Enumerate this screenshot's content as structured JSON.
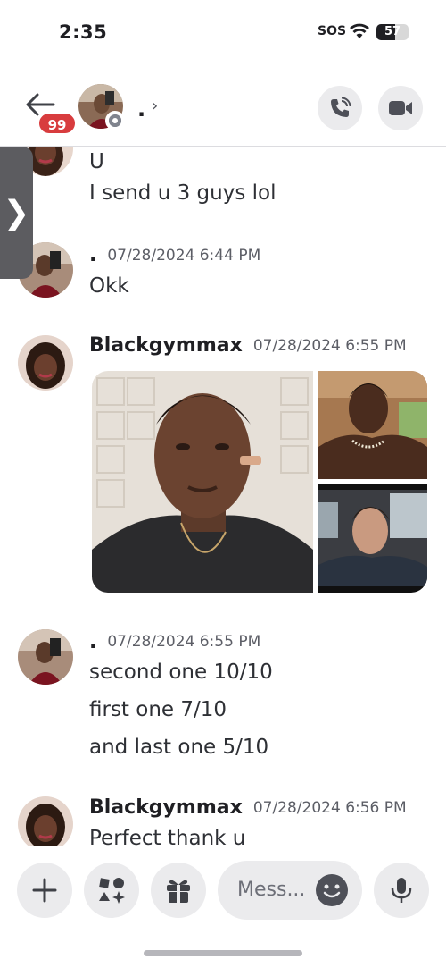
{
  "status_bar": {
    "time": "2:35",
    "sos": "SOS",
    "battery_level": "57",
    "battery_fraction": 0.57
  },
  "header": {
    "unread_badge": "99",
    "channel_name": ".",
    "chevron": "›",
    "icons": {
      "back": "back-arrow-icon",
      "call": "phone-call-icon",
      "video": "video-camera-icon"
    }
  },
  "side_handle": {
    "glyph": "❯"
  },
  "messages": [
    {
      "author": "",
      "timestamp": "",
      "lines": [
        "U",
        "I send u 3 guys lol"
      ]
    },
    {
      "author": ".",
      "timestamp": "07/28/2024 6:44 PM",
      "lines": [
        "Okk"
      ]
    },
    {
      "author": "Blackgymmax",
      "timestamp": "07/28/2024 6:55 PM",
      "lines": [],
      "attachments": 3
    },
    {
      "author": ".",
      "timestamp": "07/28/2024 6:55 PM",
      "lines": [
        "second one 10/10",
        "first one 7/10",
        "and last one 5/10"
      ]
    },
    {
      "author": "Blackgymmax",
      "timestamp": "07/28/2024 6:56 PM",
      "lines": [
        "Perfect thank u"
      ]
    }
  ],
  "composer": {
    "placeholder": "Mess...",
    "icons": {
      "add": "plus-icon",
      "apps": "apps-icon",
      "gift": "gift-icon",
      "emoji": "emoji-icon",
      "mic": "microphone-icon"
    }
  },
  "colors": {
    "badge": "#d83c3e",
    "button_bg": "#ebebed",
    "text": "#2e3035",
    "timestamp": "#5c5e66"
  }
}
